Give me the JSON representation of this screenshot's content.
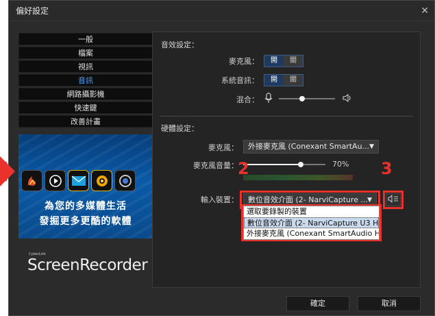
{
  "window": {
    "title": "偏好設定",
    "close_glyph": "✕"
  },
  "nav": {
    "items": [
      "一般",
      "檔案",
      "視訊",
      "音訊",
      "網路攝影機",
      "快速鍵",
      "改善計畫"
    ],
    "active_index": 3
  },
  "banner": {
    "line1": "為您的多媒體生活",
    "line2": "發掘更多更酷的軟體",
    "app_icons": [
      "flame-app-icon",
      "play-app-icon",
      "mail-app-icon",
      "aperture-app-icon",
      "lens-app-icon"
    ]
  },
  "brand": {
    "small": "CyberLink",
    "name": "ScreenRecorder"
  },
  "audio": {
    "section_title": "音效設定：",
    "mic_label": "麥克風：",
    "mic_on": "開",
    "mic_off": "關",
    "system_label": "系統音訊：",
    "system_on": "開",
    "system_off": "關",
    "mix_label": "混合：",
    "mix_level": 0.42
  },
  "hardware": {
    "section_title": "硬體設定：",
    "mic_label": "麥克風：",
    "mic_value": "外接麥克風 (Conexant SmartAu...",
    "volume_label": "麥克風音量：",
    "volume_value": "70%",
    "volume_level": 0.7,
    "input_label": "輸入裝置：",
    "input_value": "數位音效介面 (2- NarviCapture ...",
    "input_options": [
      "選取要錄製的裝置",
      "數位音效介面 (2- NarviCapture U3 H...",
      "外接麥克風 (Conexant SmartAudio H..."
    ],
    "selected_option": 1
  },
  "annotations": {
    "num2": "2",
    "num3": "3",
    "color": "#e8322b"
  },
  "buttons": {
    "ok": "確定",
    "cancel": "取消"
  },
  "colors": {
    "accent": "#4da3ff",
    "toggle_on": "#1f3a60",
    "panel_bg": "#242424"
  }
}
